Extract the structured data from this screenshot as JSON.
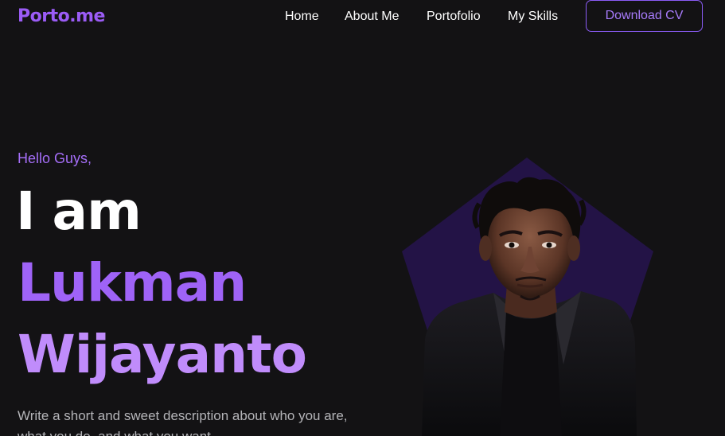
{
  "brand": {
    "logo_text": "Porto.me"
  },
  "nav": {
    "items": [
      {
        "label": "Home"
      },
      {
        "label": "About Me"
      },
      {
        "label": "Portofolio"
      },
      {
        "label": "My Skills"
      }
    ],
    "cta_label": "Download CV"
  },
  "hero": {
    "greeting": "Hello Guys,",
    "intro": "I am",
    "first_name": "Lukman",
    "last_name": "Wijayanto",
    "description": "Write a short and sweet description about who you are, what you do, and what you want"
  },
  "colors": {
    "background": "#131214",
    "accent": "#9b5cf6",
    "accent_light": "#c08cfb",
    "pentagon": "#231346"
  },
  "portrait": {
    "icon": "person-photo"
  }
}
